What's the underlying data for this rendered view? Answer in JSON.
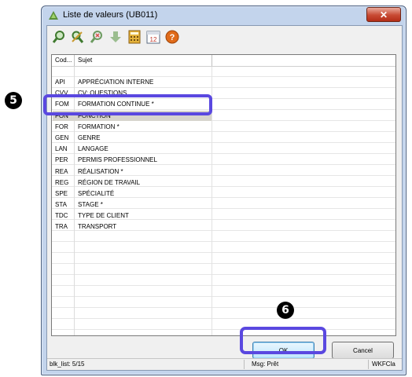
{
  "window": {
    "title": "Liste de valeurs (UB011)",
    "close_label": "✕"
  },
  "toolbar": {
    "icons": [
      "search-icon",
      "edit-search-icon",
      "clear-search-icon",
      "download-icon",
      "calculator-icon",
      "calendar-icon",
      "help-icon"
    ],
    "calendar_text": "12",
    "help_text": "?"
  },
  "list": {
    "columns": [
      "Cod...",
      "Sujet"
    ],
    "rows": [
      {
        "code": "API",
        "subject": "APPRÉCIATION INTERNE"
      },
      {
        "code": "CVV",
        "subject": "CV: QUESTIONS"
      },
      {
        "code": "FOM",
        "subject": "FORMATION CONTINUE *"
      },
      {
        "code": "FON",
        "subject": "FONCTION"
      },
      {
        "code": "FOR",
        "subject": "FORMATION *"
      },
      {
        "code": "GEN",
        "subject": "GENRE"
      },
      {
        "code": "LAN",
        "subject": "LANGAGE"
      },
      {
        "code": "PER",
        "subject": "PERMIS PROFESSIONNEL"
      },
      {
        "code": "REA",
        "subject": "RÉALISATION *"
      },
      {
        "code": "REG",
        "subject": "RÉGION DE TRAVAIL"
      },
      {
        "code": "SPE",
        "subject": "SPÉCIALITÉ"
      },
      {
        "code": "STA",
        "subject": "STAGE *"
      },
      {
        "code": "TDC",
        "subject": "TYPE DE CLIENT"
      },
      {
        "code": "TRA",
        "subject": "TRANSPORT"
      }
    ],
    "selected_code": "FON"
  },
  "buttons": {
    "ok_label": "OK",
    "cancel_label": "Cancel"
  },
  "status": {
    "left": "blk_list: 5/15",
    "middle": "Msg: Prêt",
    "right": "WKFCla"
  },
  "callouts": {
    "step_row": "5",
    "step_ok": "6"
  },
  "colors": {
    "highlight": "#5a48e0",
    "selection": "#d7d4cd"
  }
}
